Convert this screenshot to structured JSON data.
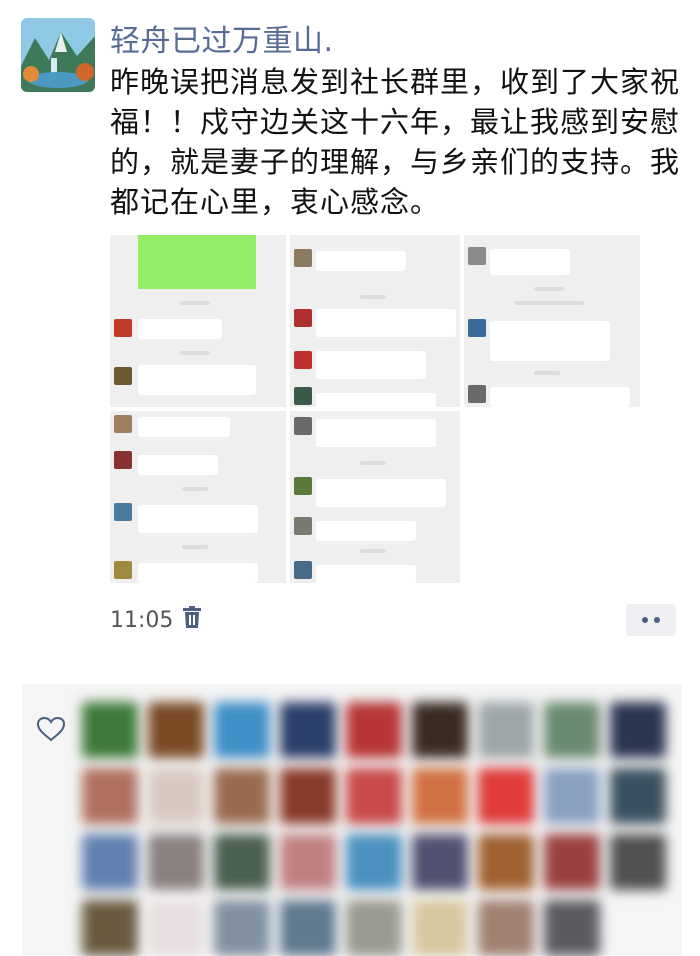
{
  "post": {
    "nickname": "轻舟已过万重山.",
    "content": "昨晚误把消息发到社长群里，收到了大家祝福！！戍守边关这十六年，最让我感到安慰的，就是妻子的理解，与乡亲们的支持。我都记在心里，衷心感念。",
    "time": "11:05"
  },
  "icons": {
    "delete": "trash-icon",
    "more": "more-dots-icon",
    "like": "heart-outline-icon"
  },
  "colors": {
    "nickname": "#576b95",
    "bubble_green": "#95ec69",
    "panel_bg": "#f5f5f5"
  },
  "likes": {
    "colors": [
      "#3d7a3a",
      "#7a4a25",
      "#3f8fc8",
      "#2b3f6b",
      "#b73535",
      "#3a2a22",
      "#9ea5a8",
      "#6a8a70",
      "#2a3550",
      "#b07060",
      "#d8c8c0",
      "#9a6a50",
      "#8a3a2a",
      "#c84a4a",
      "#d07040",
      "#e03a3a",
      "#8aa0c0",
      "#3a5060",
      "#6080b0",
      "#8a8080",
      "#4a6050",
      "#c08080",
      "#4a90c0",
      "#505070",
      "#a06030",
      "#9a4040",
      "#505050",
      "#6a5a40",
      "#e8e0e0",
      "#8090a0",
      "#607a90",
      "#9a9a90",
      "#d8c8a0",
      "#a08070",
      "#5a5a60"
    ]
  }
}
